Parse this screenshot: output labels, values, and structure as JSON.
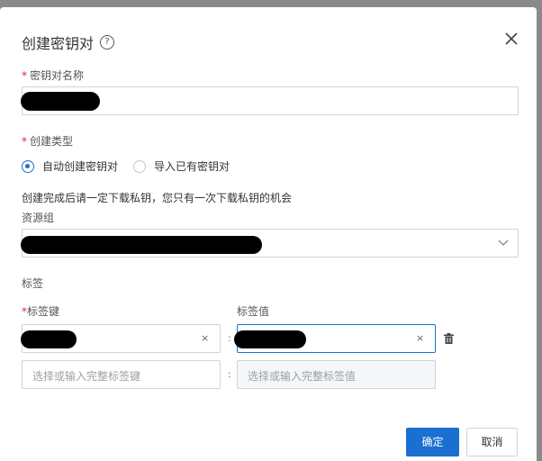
{
  "dialog": {
    "title": "创建密钥对",
    "help_icon": "?",
    "close_icon": "close-icon"
  },
  "form": {
    "name": {
      "required_mark": "*",
      "label": "密钥对名称"
    },
    "create_type": {
      "required_mark": "*",
      "label": "创建类型",
      "options": [
        {
          "label": "自动创建密钥对",
          "selected": true
        },
        {
          "label": "导入已有密钥对",
          "selected": false
        }
      ],
      "hint": "创建完成后请一定下载私钥，您只有一次下载私钥的机会"
    },
    "resource_group": {
      "label": "资源组"
    },
    "tags": {
      "section_label": "标签",
      "key_label_mark": "*",
      "key_label": "标签键",
      "value_label": "标签值",
      "clear_glyph": "×",
      "separator": ":",
      "key_placeholder": "选择或输入完整标签键",
      "value_placeholder": "选择或输入完整标签值"
    }
  },
  "footer": {
    "confirm": "确定",
    "cancel": "取消"
  },
  "colors": {
    "accent": "#1a6fd1",
    "required": "#e0282e"
  }
}
